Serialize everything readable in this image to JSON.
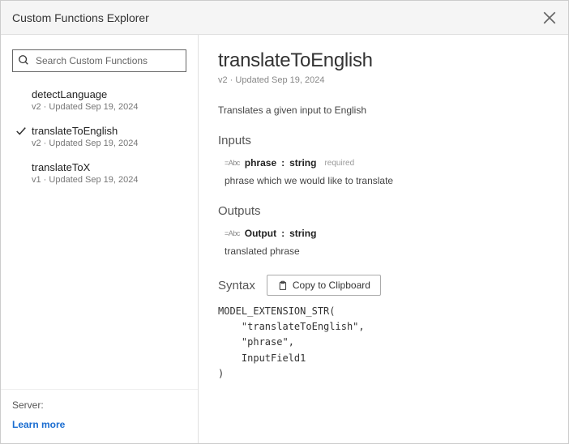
{
  "header": {
    "title": "Custom Functions Explorer"
  },
  "sidebar": {
    "search_placeholder": "Search Custom Functions",
    "items": [
      {
        "name": "detectLanguage",
        "meta": "v2 · Updated Sep 19, 2024",
        "selected": false
      },
      {
        "name": "translateToEnglish",
        "meta": "v2 · Updated Sep 19, 2024",
        "selected": true
      },
      {
        "name": "translateToX",
        "meta": "v1 · Updated Sep 19, 2024",
        "selected": false
      }
    ],
    "server_label": "Server:",
    "learn_more": "Learn more"
  },
  "detail": {
    "title": "translateToEnglish",
    "meta": "v2 · Updated Sep 19, 2024",
    "description": "Translates a given input to English",
    "inputs_heading": "Inputs",
    "inputs": [
      {
        "type_badge": "=Abc",
        "name": "phrase",
        "colon": ":",
        "type": "string",
        "required": "required",
        "desc": "phrase which we would like to translate"
      }
    ],
    "outputs_heading": "Outputs",
    "outputs": [
      {
        "type_badge": "=Abc",
        "name": "Output",
        "colon": ":",
        "type": "string",
        "desc": "translated phrase"
      }
    ],
    "syntax_label": "Syntax",
    "copy_label": "Copy to Clipboard",
    "code": "MODEL_EXTENSION_STR(\n    \"translateToEnglish\",\n    \"phrase\",\n    InputField1\n)"
  }
}
